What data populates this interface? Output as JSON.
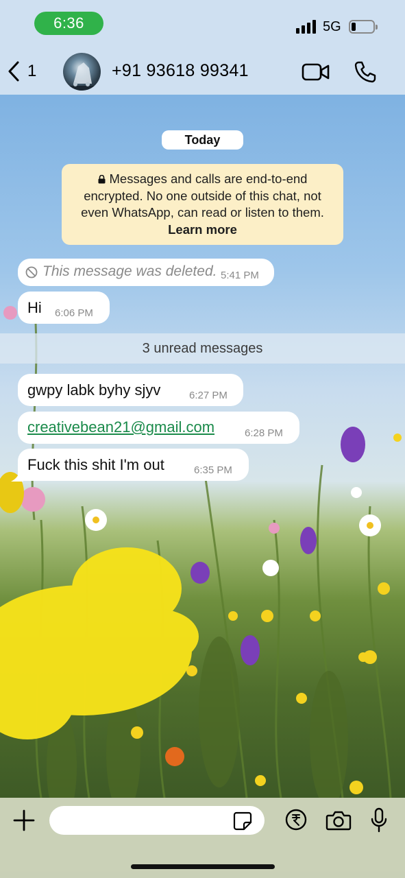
{
  "status_bar": {
    "time": "6:36",
    "network": "5G",
    "time_pill_color": "#30b24a"
  },
  "header": {
    "back_count": "1",
    "contact_name": "+91 93618 99341"
  },
  "chat": {
    "date_chip": "Today",
    "encryption_notice": {
      "text": "Messages and calls are end-to-end encrypted. No one outside of this chat, not even WhatsApp, can read or listen to them.",
      "link": "Learn more"
    },
    "messages_before": [
      {
        "text": "This message was deleted.",
        "time": "5:41 PM",
        "deleted": true
      },
      {
        "text": "Hi",
        "time": "6:06 PM"
      }
    ],
    "unread_label": "3 unread messages",
    "messages_after": [
      {
        "text": "gwpy labk byhy sjyv",
        "time": "6:27 PM"
      },
      {
        "text": "creativebean21@gmail.com",
        "time": "6:28 PM",
        "link": true
      },
      {
        "text": "Fuck this shit I'm out",
        "time": "6:35 PM"
      }
    ]
  },
  "composer": {
    "placeholder": ""
  },
  "colors": {
    "header_bg": "#cfe0f1",
    "link_green": "#1a8a4a",
    "notice_bg": "#fcefc7"
  }
}
